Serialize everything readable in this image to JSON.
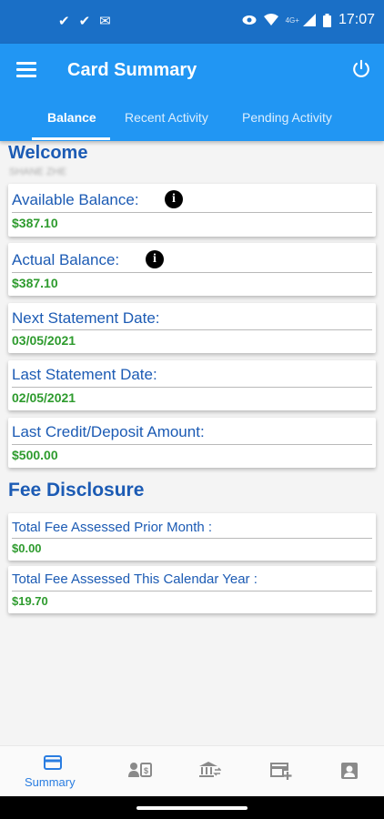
{
  "status_bar": {
    "time": "17:07",
    "network": "4G+"
  },
  "app_bar": {
    "title": "Card Summary",
    "tabs": [
      {
        "label": "Balance",
        "active": true
      },
      {
        "label": "Recent Activity",
        "active": false
      },
      {
        "label": "Pending Activity",
        "active": false
      }
    ]
  },
  "welcome": {
    "heading": "Welcome",
    "user_name": "SHANE ZHE"
  },
  "balance_cards": [
    {
      "label": "Available Balance:",
      "value": "$387.10",
      "has_info": true
    },
    {
      "label": "Actual Balance:",
      "value": "$387.10",
      "has_info": true
    },
    {
      "label": "Next Statement Date:",
      "value": "03/05/2021",
      "has_info": false
    },
    {
      "label": "Last Statement Date:",
      "value": "02/05/2021",
      "has_info": false
    },
    {
      "label": "Last Credit/Deposit Amount:",
      "value": "$500.00",
      "has_info": false
    }
  ],
  "fee_disclosure": {
    "title": "Fee Disclosure",
    "items": [
      {
        "label": "Total Fee Assessed Prior Month :",
        "value": "$0.00"
      },
      {
        "label": "Total Fee Assessed This Calendar Year :",
        "value": "$19.70"
      }
    ]
  },
  "bottom_nav": {
    "items": [
      {
        "label": "Summary",
        "icon": "card-icon",
        "active": true
      },
      {
        "label": "",
        "icon": "transfer-icon",
        "active": false
      },
      {
        "label": "",
        "icon": "bank-icon",
        "active": false
      },
      {
        "label": "",
        "icon": "add-card-icon",
        "active": false
      },
      {
        "label": "",
        "icon": "contact-icon",
        "active": false
      }
    ]
  },
  "colors": {
    "status_bar": "#1a6fc6",
    "app_bar": "#2196f3",
    "heading_blue": "#1c5bb4",
    "value_green": "#2e9b2e",
    "nav_active": "#2a7de1",
    "nav_inactive": "#8a8a8a"
  }
}
